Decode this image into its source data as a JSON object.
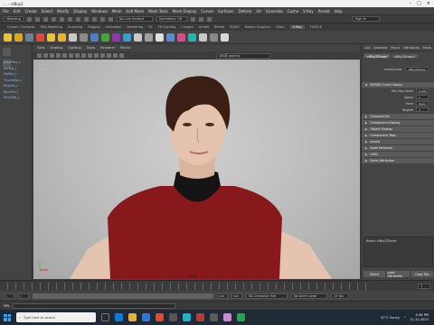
{
  "window": {
    "title": "... - ctBoy2"
  },
  "menubar": {
    "items": [
      "File",
      "Edit",
      "Create",
      "Select",
      "Modify",
      "Display",
      "Windows",
      "Mesh",
      "Edit Mesh",
      "Mesh Tools",
      "Mesh Display",
      "Curves",
      "Surfaces",
      "Deform",
      "UV",
      "Generate",
      "Cache",
      "V-Ray",
      "Arnold",
      "Help"
    ]
  },
  "statusline": {
    "workspace": "Modeling",
    "no_live_surface": "No Live Surface",
    "symmetry": "Symmetry: Off",
    "sign_in": "Sign In"
  },
  "shelf_tabs": {
    "items": [
      "Curves / Surfaces",
      "Poly Modeling",
      "Sculpting",
      "Rigging",
      "Animation",
      "Rendering",
      "FX",
      "FX Caching",
      "Custom",
      "Arnold",
      "Bifrost",
      "MASH",
      "Motion Graphics",
      "XGen",
      "V-Ray",
      "TURTLE"
    ],
    "active_index": 14
  },
  "outliner": {
    "items": [
      "basePose_L",
      "AntRot_L",
      "MidToe_L",
      "ThumbRot_L",
      "RingRot_L",
      "BackToe_L",
      "PinkyRot_L"
    ]
  },
  "viewport": {
    "menu": [
      "View",
      "Shading",
      "Lighting",
      "Show",
      "Renderer",
      "Panels"
    ],
    "resolution_text": "sRGB gamma",
    "hud": [
      "Verts:",
      "Edges:",
      "Faces:",
      "Tris:",
      "UVs:"
    ],
    "camera_label": "persp"
  },
  "attribute_editor": {
    "top_tabs": [
      "List",
      "Selected",
      "Focus",
      "Attributes",
      "Show",
      "Help"
    ],
    "node_tabs": [
      "ctBoy2Shape",
      "ctBoy2Shape1"
    ],
    "node_label": "nurbsCurve:",
    "node_value": "ctBoy2Shape",
    "sections": [
      {
        "label": "NURBS Curve History",
        "open": true
      },
      {
        "label": "Components",
        "open": false
      },
      {
        "label": "Component Display",
        "open": false
      },
      {
        "label": "Object Display",
        "open": false
      },
      {
        "label": "Component Tags",
        "open": false
      },
      {
        "label": "Arnold",
        "open": false
      },
      {
        "label": "Node Behavior",
        "open": false
      },
      {
        "label": "UUID",
        "open": false
      },
      {
        "label": "Extra Attributes",
        "open": false
      }
    ],
    "history_rows": [
      {
        "label": "Min Max Value",
        "value": "0.000"
      },
      {
        "label": "Spans",
        "value": "1"
      },
      {
        "label": "Form",
        "value": "Open"
      },
      {
        "label": "Degree",
        "value": "3"
      }
    ],
    "notes_label": "Notes: ctBoy2Shape",
    "buttons": [
      "Select",
      "Load Attributes",
      "Copy Tab"
    ]
  },
  "timeline": {
    "start": "1",
    "end": "120",
    "current": "1"
  },
  "range": {
    "start": "1",
    "inner_start": "1",
    "inner_end": "120",
    "end": "200",
    "char_set": "No Character Set",
    "anim_layer": "No Anim Layer",
    "fps": "24 fps"
  },
  "cmdline": {
    "label": "MEL"
  },
  "taskbar": {
    "search_placeholder": "Type here to search",
    "weather": "31°C Sunny",
    "time": "4:36 PM",
    "date": "11-12-2022"
  },
  "colors": {
    "viewport_bg": "#c2c2c2",
    "shelf_accent": "#e8c242",
    "selection_blue": "#8fb8e6",
    "taskbar_bg": "#202a36"
  }
}
